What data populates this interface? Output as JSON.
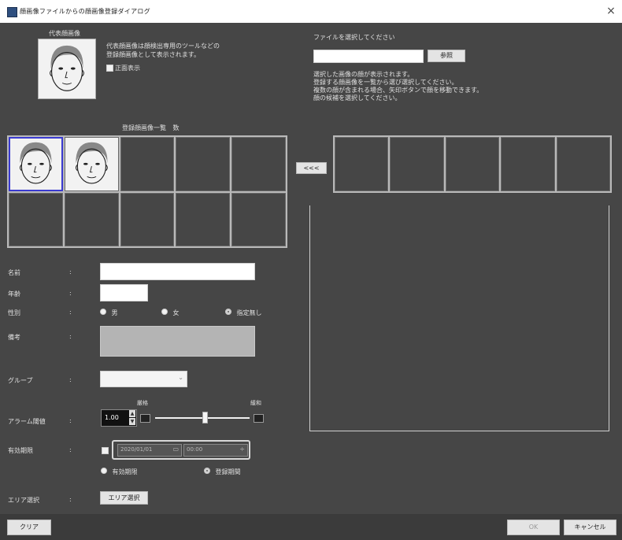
{
  "window": {
    "title": "顔画像ファイルからの顔画像登録ダイアログ",
    "close_glyph": "×",
    "icon": "app-icon"
  },
  "representative": {
    "label": "代表顔画像",
    "description_line1": "代表顔画像は顔検出専用のツールなどの",
    "description_line2": "登録顔画像として表示されます。",
    "checkbox_label": "正面表示"
  },
  "file_select": {
    "prompt": "ファイルを選択してください",
    "input_value": "",
    "browse_label": "参照",
    "help_line1": "選択した画像の顔が表示されます。",
    "help_line2": "登録する顔画像を一覧から選び選択してください。",
    "help_line3": "複数の顔が含まれる場合、矢印ボタンで顔を移動できます。",
    "help_line4": "顔の候補を選択してください。"
  },
  "registered_grid": {
    "label": "登録顔画像一覧",
    "count_label": "数",
    "face_cells": 2,
    "total_cells": 10
  },
  "transfer_button": {
    "label": "<<<"
  },
  "candidates": {
    "total_cells": 5
  },
  "form": {
    "name_label": "名前",
    "age_label": "年齢",
    "gender_label": "性別",
    "gender_options": [
      "男",
      "女",
      "指定無し"
    ],
    "memo_label": "備考",
    "group_label": "グループ",
    "threshold_label": "アラーム閾値",
    "threshold_value": "1.00",
    "threshold_low": "厳格",
    "threshold_high": "緩和",
    "threshold_level": 0.53,
    "period_label": "有効期限",
    "period_date": "2020/01/01",
    "period_time": "00:00",
    "period_options": [
      "有効期限",
      "登録期間"
    ],
    "area_label": "エリア選択",
    "area_button": "エリア選択",
    "colon": ":"
  },
  "footer": {
    "clear_label": "クリア",
    "ok_label": "OK",
    "cancel_label": "キャンセル"
  },
  "colors": {
    "background": "#464646",
    "selected_outline": "#3a3ad0",
    "field_white": "#ffffff",
    "memo_gray": "#b4b4b4"
  }
}
